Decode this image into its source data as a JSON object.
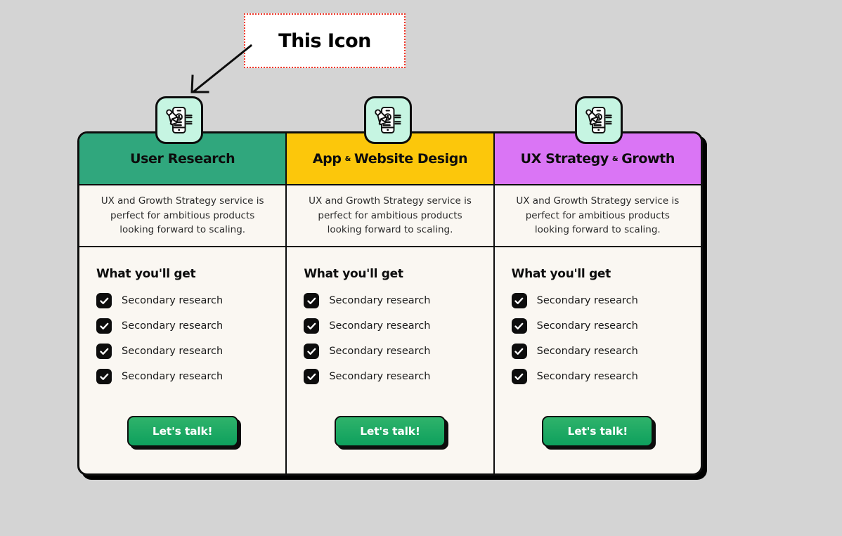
{
  "annotation": {
    "callout_label": "This Icon",
    "callout_border_color": "#f0382a",
    "arrow_icon": "arrow-down-left-icon"
  },
  "theme": {
    "page_background": "#d4d4d4",
    "card_background": "#faf7f2",
    "border_color": "#0d0d0d",
    "icon_badge_background": "#c6f5e2",
    "button_gradient_top": "#2fb36b",
    "button_gradient_bottom": "#0ea05d",
    "checkbox_color": "#0d0d0d"
  },
  "shared": {
    "body_heading": "What you'll get",
    "cta_label": "Let's talk!",
    "badge_icon_name": "mobile-profile-edit-icon",
    "check_icon_name": "checkmark-icon"
  },
  "columns": [
    {
      "id": "user-research",
      "title_parts": {
        "lead": "User Research",
        "separator": "",
        "trail": ""
      },
      "title": "User Research",
      "header_color": "#30a77d",
      "description": "UX and Growth Strategy service is perfect for ambitious products looking forward to scaling.",
      "body_heading": "What you'll get",
      "features": [
        "Secondary research",
        "Secondary research",
        "Secondary research",
        "Secondary research"
      ],
      "cta_label": "Let's talk!"
    },
    {
      "id": "app-website-design",
      "title_parts": {
        "lead": "App",
        "separator": "&",
        "trail": "Website Design"
      },
      "title": "App & Website Design",
      "header_color": "#fcc70b",
      "description": "UX and Growth Strategy service is perfect for ambitious products looking forward to scaling.",
      "body_heading": "What you'll get",
      "features": [
        "Secondary research",
        "Secondary research",
        "Secondary research",
        "Secondary research"
      ],
      "cta_label": "Let's talk!"
    },
    {
      "id": "ux-strategy-growth",
      "title_parts": {
        "lead": "UX Strategy",
        "separator": "&",
        "trail": "Growth"
      },
      "title": "UX Strategy & Growth",
      "header_color": "#da75f5",
      "description": "UX and Growth Strategy service is perfect for ambitious products looking forward to scaling.",
      "body_heading": "What you'll get",
      "features": [
        "Secondary research",
        "Secondary research",
        "Secondary research",
        "Secondary research"
      ],
      "cta_label": "Let's talk!"
    }
  ]
}
